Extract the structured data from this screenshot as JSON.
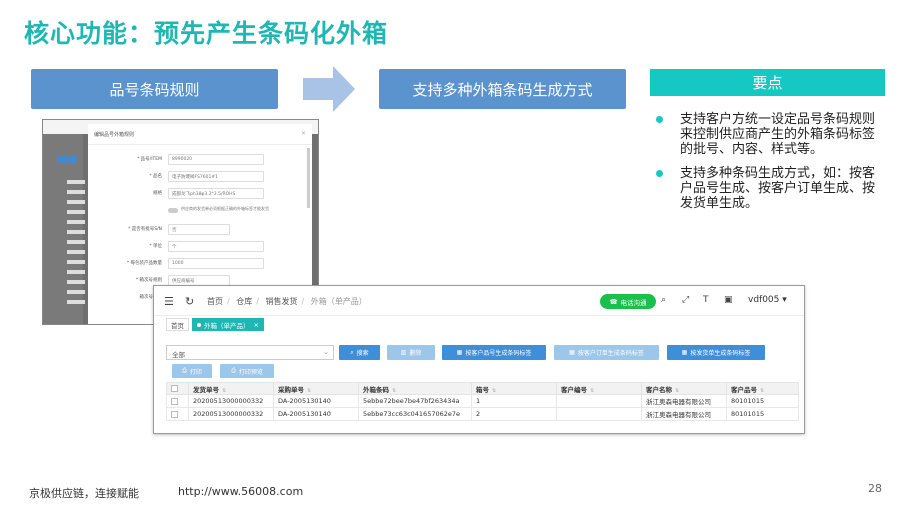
{
  "slide": {
    "title": "核心功能：预先产生条码化外箱",
    "flow_left": "品号条码规则",
    "flow_right": "支持多种外箱条码生成方式",
    "req_title": "要点",
    "bullets": [
      "支持客户方统一设定品号条码规则来控制供应商产生的外箱条码标签的批号、内容、样式等。",
      "支持多种条码生成方式，如：按客户品号生成、按客户订单生成、按发货单生成。"
    ],
    "footer_left": "京极供应链，连接赋能",
    "footer_url": "http://www.56008.com",
    "page_number": "28",
    "accent_color": "#1fb7b3",
    "flow_color": "#5b93cf"
  },
  "modal": {
    "title": "编辑品号外箱规则",
    "close": "×",
    "fields": [
      {
        "label": "* 品号/ITEM",
        "value": "8990020"
      },
      {
        "label": "* 品名",
        "value": "电子防爆阀FS7601#1"
      },
      {
        "label": "规格",
        "value": "成都龙飞ph38φ3.2*3.5/ROHS"
      }
    ],
    "toggle_note": "供应商的发货单必须根据正确的外箱标签才能发货",
    "fields2": [
      {
        "label": "* 是否有批号S/N",
        "value": "否"
      },
      {
        "label": "* 单位",
        "value": "个"
      },
      {
        "label": "* 每包装产品数量",
        "value": "1000"
      },
      {
        "label": "* 箱次号规则",
        "value": "供应商编号"
      },
      {
        "label": "箱次号前缀",
        "value": ""
      }
    ]
  },
  "app": {
    "breadcrumb": [
      "首页",
      "仓库",
      "销售发货",
      "外箱（单产品）"
    ],
    "phone_btn": "电话沟通",
    "font_icon": "T",
    "user": "vdf005",
    "tabs": [
      {
        "label": "首页",
        "active": false
      },
      {
        "label": "外箱（单产品）",
        "active": true
      }
    ],
    "tab_close": "×",
    "select_value": "全部",
    "buttons": {
      "search": "搜索",
      "delete": "删除",
      "by_item": "按客户品号生成条码标签",
      "by_order": "按客户订单生成条码标签",
      "by_ship": "按发货单生成条码标签",
      "print": "打印",
      "print_preview": "打印预览"
    },
    "columns": [
      "发货单号",
      "采购单号",
      "外箱条码",
      "箱号",
      "客户编号",
      "客户名称",
      "客户品号"
    ],
    "rows": [
      [
        "20200513000000332",
        "DA-2005130140",
        "5ebbe72bee7be47bf263434a",
        "1",
        "",
        "浙江奥森电器有限公司",
        "80101015"
      ],
      [
        "20200513000000332",
        "DA-2005130140",
        "5ebbe73cc63c041657062e7e",
        "2",
        "",
        "浙江奥森电器有限公司",
        "80101015"
      ]
    ]
  }
}
